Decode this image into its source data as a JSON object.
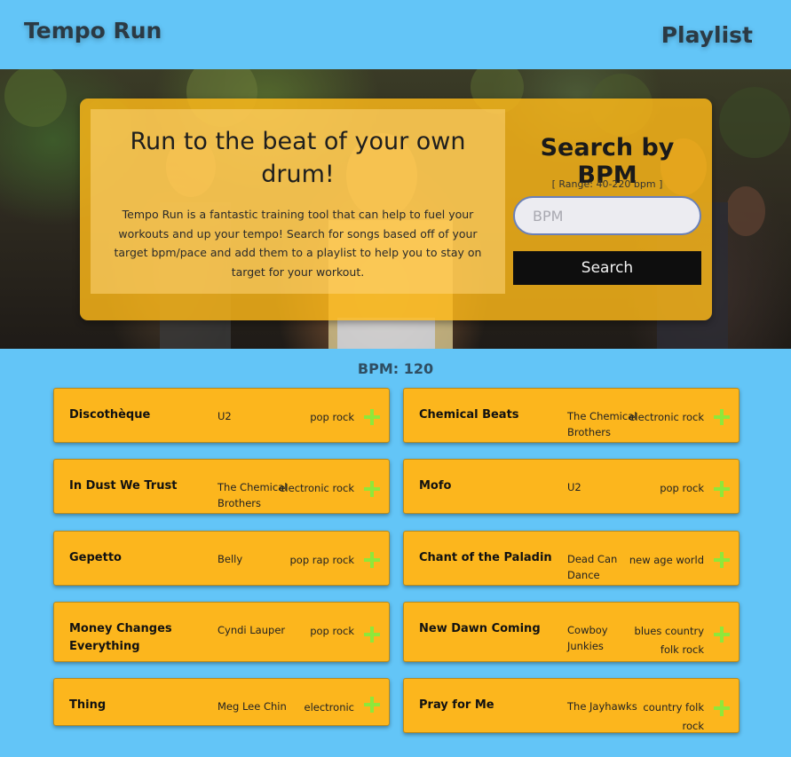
{
  "header": {
    "brand": "Tempo Run",
    "nav_playlist": "Playlist"
  },
  "hero": {
    "title": "Run to the beat of your own drum!",
    "description": "Tempo Run is a fantastic training tool that can help to fuel your workouts and up your tempo! Search for songs based off of your target bpm/pace and add them to a playlist to help you to stay on target for your workout.",
    "search_title": "Search by BPM",
    "range_text": "[ Range: 40-220 bpm ]",
    "input_placeholder": "BPM",
    "input_value": "",
    "search_button": "Search"
  },
  "results": {
    "bpm_label": "BPM: 120",
    "songs": [
      {
        "title": "Discothèque",
        "artist": "U2",
        "genre": "pop rock"
      },
      {
        "title": "Chemical Beats",
        "artist": "The Chemical Brothers",
        "genre": "electronic rock"
      },
      {
        "title": "In Dust We Trust",
        "artist": "The Chemical Brothers",
        "genre": "electronic rock"
      },
      {
        "title": "Mofo",
        "artist": "U2",
        "genre": "pop rock"
      },
      {
        "title": "Gepetto",
        "artist": "Belly",
        "genre": "pop rap rock"
      },
      {
        "title": "Chant of the Paladin",
        "artist": "Dead Can Dance",
        "genre": "new age world"
      },
      {
        "title": "Money Changes Everything",
        "artist": "Cyndi Lauper",
        "genre": "pop rock"
      },
      {
        "title": "New Dawn Coming",
        "artist": "Cowboy Junkies",
        "genre": "blues country folk rock"
      },
      {
        "title": "Thing",
        "artist": "Meg Lee Chin",
        "genre": "electronic"
      },
      {
        "title": "Pray for Me",
        "artist": "The Jayhawks",
        "genre": "country folk rock"
      }
    ]
  },
  "icons": {
    "add": "plus-icon"
  },
  "colors": {
    "page_background": "#63c5f7",
    "card_background": "#fcb61d",
    "add_icon": "#8ee83a",
    "search_button": "#0e0e0e"
  }
}
